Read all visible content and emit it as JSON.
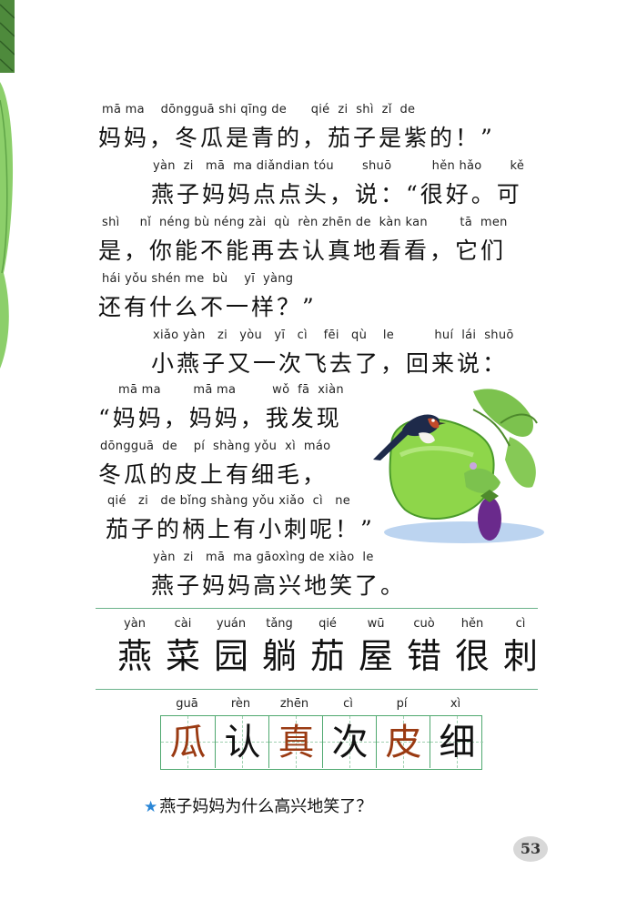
{
  "story": [
    {
      "pinyin": "mā ma    dōngguā shi qīng de      qié  zi  shì  zǐ  de",
      "text": "妈妈，冬瓜是青的，茄子是紫的！”"
    },
    {
      "pinyin": "yàn  zi   mā  ma diǎndian tóu       shuō          hěn hǎo       kě",
      "text": "燕子妈妈点点头，说：“很好。可"
    },
    {
      "pinyin": "shì     nǐ  néng bù néng zài  qù  rèn zhēn de  kàn kan        tā  men",
      "text": "是，你能不能再去认真地看看，它们"
    },
    {
      "pinyin": "hái yǒu shén me  bù    yī  yàng",
      "text": "还有什么不一样？”"
    },
    {
      "pinyin": "xiǎo yàn   zi   yòu   yī   cì    fēi   qù    le          huí  lái  shuō",
      "text": "小燕子又一次飞去了，回来说："
    },
    {
      "pinyin": "mā ma        mā ma         wǒ  fā  xiàn",
      "text": "“妈妈，妈妈，我发现"
    },
    {
      "pinyin": "dōngguā  de    pí  shàng yǒu  xì  máo",
      "text": "冬瓜的皮上有细毛，"
    },
    {
      "pinyin": "qié   zi   de bǐng shàng yǒu xiǎo  cì   ne",
      "text": "茄子的柄上有小刺呢！”"
    },
    {
      "pinyin": "yàn  zi   mā  ma gāoxìng de xiào  le",
      "text": "燕子妈妈高兴地笑了。"
    }
  ],
  "vocabulary": [
    {
      "pinyin": "yàn",
      "char": "燕"
    },
    {
      "pinyin": "cài",
      "char": "菜"
    },
    {
      "pinyin": "yuán",
      "char": "园"
    },
    {
      "pinyin": "tǎng",
      "char": "躺"
    },
    {
      "pinyin": "qié",
      "char": "茄"
    },
    {
      "pinyin": "wū",
      "char": "屋"
    },
    {
      "pinyin": "cuò",
      "char": "错"
    },
    {
      "pinyin": "hěn",
      "char": "很"
    },
    {
      "pinyin": "cì",
      "char": "刺"
    }
  ],
  "writing": [
    {
      "pinyin": "guā",
      "char": "瓜",
      "color": "#9a3a12"
    },
    {
      "pinyin": "rèn",
      "char": "认",
      "color": "#111111"
    },
    {
      "pinyin": "zhēn",
      "char": "真",
      "color": "#9a3a12"
    },
    {
      "pinyin": "cì",
      "char": "次",
      "color": "#111111"
    },
    {
      "pinyin": "pí",
      "char": "皮",
      "color": "#9a3a12"
    },
    {
      "pinyin": "xì",
      "char": "细",
      "color": "#111111"
    }
  ],
  "question": "燕子妈妈为什么高兴地笑了？",
  "page_number": "53",
  "colors": {
    "rule": "#6ab28a",
    "star": "#2a86d6",
    "highlight_char": "#9a3a12",
    "page_badge": "#d8d8d8"
  }
}
